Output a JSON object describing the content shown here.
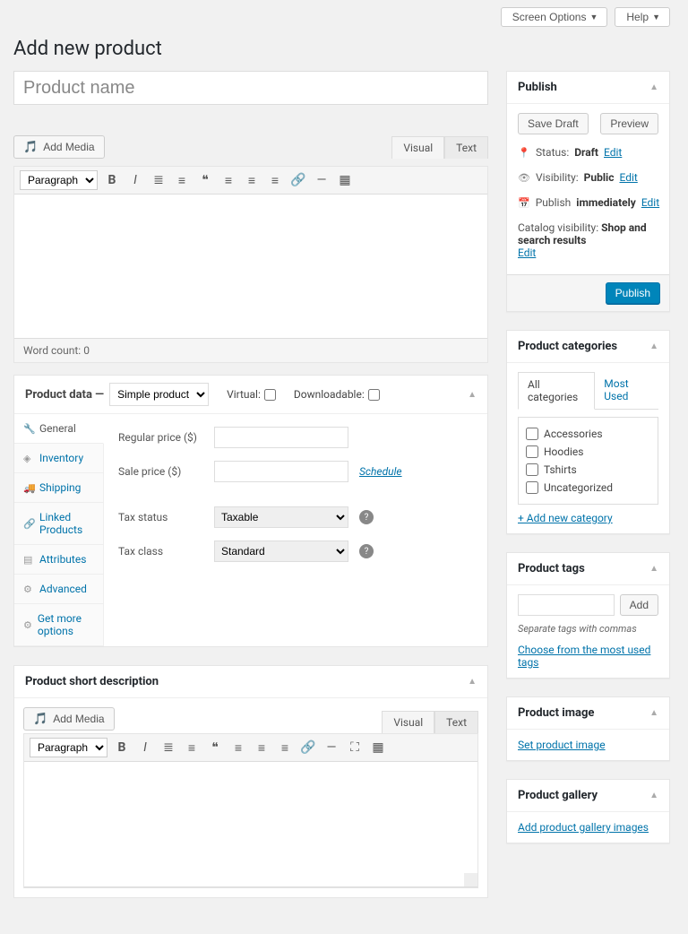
{
  "topbar": {
    "screen_options": "Screen Options",
    "help": "Help"
  },
  "page_title": "Add new product",
  "title_field": {
    "placeholder": "Product name",
    "value": ""
  },
  "editor_main": {
    "add_media": "Add Media",
    "tabs": {
      "visual": "Visual",
      "text": "Text"
    },
    "format_select": "Paragraph",
    "word_count_label": "Word count:",
    "word_count_value": "0"
  },
  "product_data": {
    "header_label": "Product data —",
    "type_select": "Simple product",
    "virtual_label": "Virtual:",
    "downloadable_label": "Downloadable:",
    "tabs": [
      {
        "icon": "wrench",
        "label": "General",
        "active": true
      },
      {
        "icon": "list",
        "label": "Inventory"
      },
      {
        "icon": "truck",
        "label": "Shipping"
      },
      {
        "icon": "link",
        "label": "Linked Products"
      },
      {
        "icon": "tag",
        "label": "Attributes"
      },
      {
        "icon": "gear",
        "label": "Advanced"
      },
      {
        "icon": "gear",
        "label": "Get more options"
      }
    ],
    "fields": {
      "regular_price": "Regular price ($)",
      "sale_price": "Sale price ($)",
      "schedule": "Schedule",
      "tax_status_label": "Tax status",
      "tax_status_value": "Taxable",
      "tax_class_label": "Tax class",
      "tax_class_value": "Standard"
    }
  },
  "short_desc": {
    "title": "Product short description",
    "add_media": "Add Media",
    "tabs": {
      "visual": "Visual",
      "text": "Text"
    },
    "format_select": "Paragraph"
  },
  "publish": {
    "title": "Publish",
    "save_draft": "Save Draft",
    "preview": "Preview",
    "status_label": "Status:",
    "status_value": "Draft",
    "visibility_label": "Visibility:",
    "visibility_value": "Public",
    "schedule_label": "Publish",
    "schedule_value": "immediately",
    "catalog_label": "Catalog visibility:",
    "catalog_value": "Shop and search results",
    "edit": "Edit",
    "publish_btn": "Publish"
  },
  "categories": {
    "title": "Product categories",
    "tab_all": "All categories",
    "tab_most": "Most Used",
    "items": [
      "Accessories",
      "Hoodies",
      "Tshirts",
      "Uncategorized"
    ],
    "add_new": "+ Add new category"
  },
  "tags": {
    "title": "Product tags",
    "add_btn": "Add",
    "hint": "Separate tags with commas",
    "choose": "Choose from the most used tags"
  },
  "image": {
    "title": "Product image",
    "link": "Set product image"
  },
  "gallery": {
    "title": "Product gallery",
    "link": "Add product gallery images"
  }
}
